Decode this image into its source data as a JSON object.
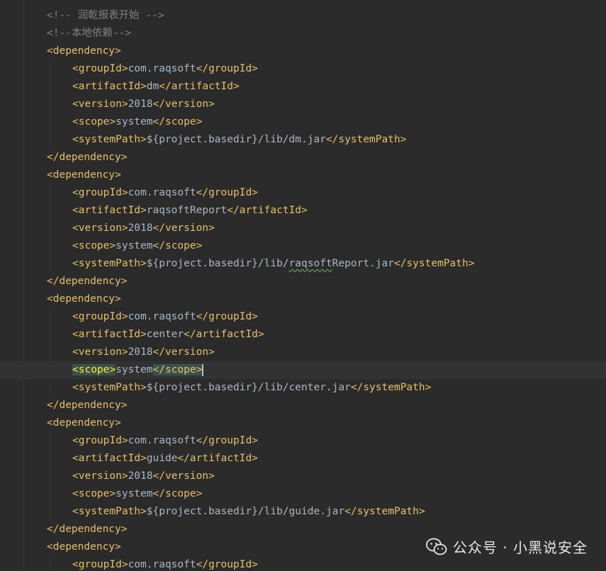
{
  "editor": {
    "lines": [
      {
        "indent": 0,
        "parts": [
          {
            "t": "comment",
            "v": "<!-- 润乾报表开始 -->"
          }
        ]
      },
      {
        "indent": 0,
        "parts": [
          {
            "t": "comment",
            "v": "<!--本地依赖-->"
          }
        ]
      },
      {
        "indent": 0,
        "parts": [
          {
            "t": "tag",
            "v": "<dependency>"
          }
        ]
      },
      {
        "indent": 1,
        "parts": [
          {
            "t": "tag",
            "v": "<groupId>"
          },
          {
            "t": "text",
            "v": "com.raqsoft"
          },
          {
            "t": "tag",
            "v": "</groupId>"
          }
        ]
      },
      {
        "indent": 1,
        "parts": [
          {
            "t": "tag",
            "v": "<artifactId>"
          },
          {
            "t": "text",
            "v": "dm"
          },
          {
            "t": "tag",
            "v": "</artifactId>"
          }
        ]
      },
      {
        "indent": 1,
        "parts": [
          {
            "t": "tag",
            "v": "<version>"
          },
          {
            "t": "text",
            "v": "2018"
          },
          {
            "t": "tag",
            "v": "</version>"
          }
        ]
      },
      {
        "indent": 1,
        "parts": [
          {
            "t": "tag",
            "v": "<scope>"
          },
          {
            "t": "text",
            "v": "system"
          },
          {
            "t": "tag",
            "v": "</scope>"
          }
        ]
      },
      {
        "indent": 1,
        "parts": [
          {
            "t": "tag",
            "v": "<systemPath>"
          },
          {
            "t": "text",
            "v": "${project.basedir}/lib/dm.jar"
          },
          {
            "t": "tag",
            "v": "</systemPath>"
          }
        ]
      },
      {
        "indent": 0,
        "parts": [
          {
            "t": "tag",
            "v": "</dependency>"
          }
        ]
      },
      {
        "indent": 0,
        "parts": [
          {
            "t": "tag",
            "v": "<dependency>"
          }
        ]
      },
      {
        "indent": 1,
        "parts": [
          {
            "t": "tag",
            "v": "<groupId>"
          },
          {
            "t": "text",
            "v": "com.raqsoft"
          },
          {
            "t": "tag",
            "v": "</groupId>"
          }
        ]
      },
      {
        "indent": 1,
        "parts": [
          {
            "t": "tag",
            "v": "<artifactId>"
          },
          {
            "t": "text",
            "v": "raqsoftReport"
          },
          {
            "t": "tag",
            "v": "</artifactId>"
          }
        ]
      },
      {
        "indent": 1,
        "parts": [
          {
            "t": "tag",
            "v": "<version>"
          },
          {
            "t": "text",
            "v": "2018"
          },
          {
            "t": "tag",
            "v": "</version>"
          }
        ]
      },
      {
        "indent": 1,
        "parts": [
          {
            "t": "tag",
            "v": "<scope>"
          },
          {
            "t": "text",
            "v": "system"
          },
          {
            "t": "tag",
            "v": "</scope>"
          }
        ]
      },
      {
        "indent": 1,
        "parts": [
          {
            "t": "tag",
            "v": "<systemPath>"
          },
          {
            "t": "text",
            "v": "${project.basedir}/lib/"
          },
          {
            "t": "squiggle",
            "v": "raqsoft"
          },
          {
            "t": "text",
            "v": "Report.jar"
          },
          {
            "t": "tag",
            "v": "</systemPath>"
          }
        ]
      },
      {
        "indent": 0,
        "parts": [
          {
            "t": "tag",
            "v": "</dependency>"
          }
        ]
      },
      {
        "indent": 0,
        "parts": [
          {
            "t": "tag",
            "v": "<dependency>"
          }
        ]
      },
      {
        "indent": 1,
        "parts": [
          {
            "t": "tag",
            "v": "<groupId>"
          },
          {
            "t": "text",
            "v": "com.raqsoft"
          },
          {
            "t": "tag",
            "v": "</groupId>"
          }
        ]
      },
      {
        "indent": 1,
        "parts": [
          {
            "t": "tag",
            "v": "<artifactId>"
          },
          {
            "t": "text",
            "v": "center"
          },
          {
            "t": "tag",
            "v": "</artifactId>"
          }
        ]
      },
      {
        "indent": 1,
        "parts": [
          {
            "t": "tag",
            "v": "<version>"
          },
          {
            "t": "text",
            "v": "2018"
          },
          {
            "t": "tag",
            "v": "</version>"
          }
        ]
      },
      {
        "indent": 1,
        "current": true,
        "parts": [
          {
            "t": "match",
            "v": "<scope>"
          },
          {
            "t": "text",
            "v": "system"
          },
          {
            "t": "matchend",
            "v": "</scope>"
          },
          {
            "t": "caret",
            "v": ""
          }
        ]
      },
      {
        "indent": 1,
        "parts": [
          {
            "t": "tag",
            "v": "<systemPath>"
          },
          {
            "t": "text",
            "v": "${project.basedir}/lib/center.jar"
          },
          {
            "t": "tag",
            "v": "</systemPath>"
          }
        ]
      },
      {
        "indent": 0,
        "parts": [
          {
            "t": "tag",
            "v": "</dependency>"
          }
        ]
      },
      {
        "indent": 0,
        "parts": [
          {
            "t": "tag",
            "v": "<dependency>"
          }
        ]
      },
      {
        "indent": 1,
        "parts": [
          {
            "t": "tag",
            "v": "<groupId>"
          },
          {
            "t": "text",
            "v": "com.raqsoft"
          },
          {
            "t": "tag",
            "v": "</groupId>"
          }
        ]
      },
      {
        "indent": 1,
        "parts": [
          {
            "t": "tag",
            "v": "<artifactId>"
          },
          {
            "t": "text",
            "v": "guide"
          },
          {
            "t": "tag",
            "v": "</artifactId>"
          }
        ]
      },
      {
        "indent": 1,
        "parts": [
          {
            "t": "tag",
            "v": "<version>"
          },
          {
            "t": "text",
            "v": "2018"
          },
          {
            "t": "tag",
            "v": "</version>"
          }
        ]
      },
      {
        "indent": 1,
        "parts": [
          {
            "t": "tag",
            "v": "<scope>"
          },
          {
            "t": "text",
            "v": "system"
          },
          {
            "t": "tag",
            "v": "</scope>"
          }
        ]
      },
      {
        "indent": 1,
        "parts": [
          {
            "t": "tag",
            "v": "<systemPath>"
          },
          {
            "t": "text",
            "v": "${project.basedir}/lib/guide.jar"
          },
          {
            "t": "tag",
            "v": "</systemPath>"
          }
        ]
      },
      {
        "indent": 0,
        "parts": [
          {
            "t": "tag",
            "v": "</dependency>"
          }
        ]
      },
      {
        "indent": 0,
        "parts": [
          {
            "t": "tag",
            "v": "<dependency>"
          }
        ]
      },
      {
        "indent": 1,
        "parts": [
          {
            "t": "tag",
            "v": "<groupId>"
          },
          {
            "t": "text",
            "v": "com.raqsoft"
          },
          {
            "t": "tag",
            "v": "</groupId>"
          }
        ]
      }
    ]
  },
  "watermark": {
    "icon": "wechat-icon",
    "text": "公众号 · 小黑说安全"
  },
  "colors": {
    "background": "#2b2b2b",
    "tag": "#e8bf6a",
    "text": "#a9b7c6",
    "comment": "#808080",
    "brace_match_bg": "#3b514d",
    "brace_match_fg": "#ffef28",
    "current_line": "#323232"
  }
}
